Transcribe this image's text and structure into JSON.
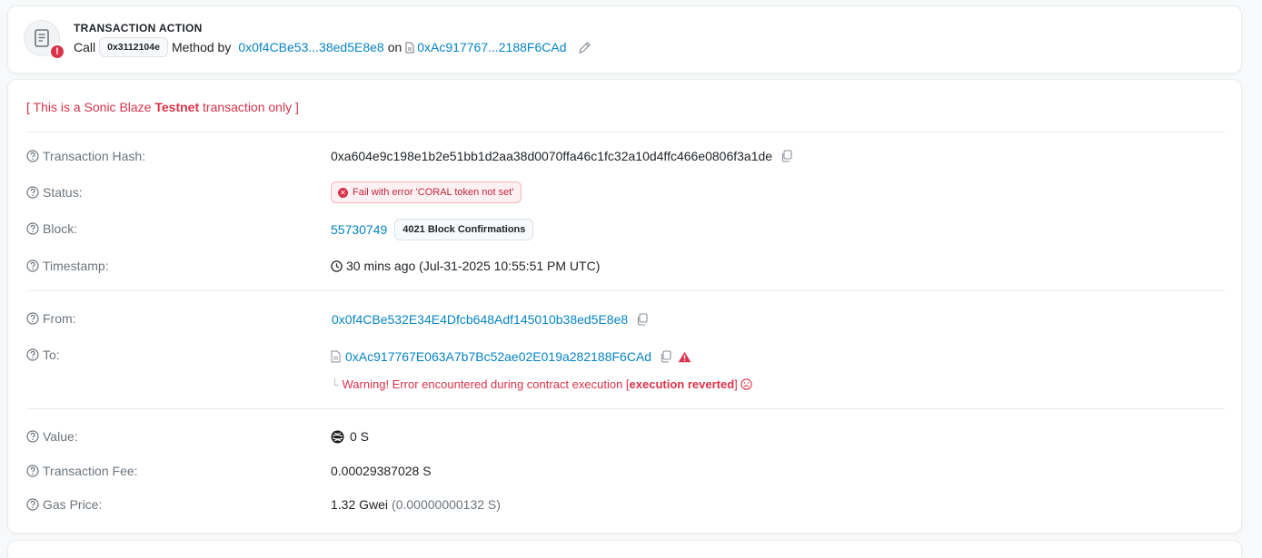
{
  "action": {
    "title": "TRANSACTION ACTION",
    "badge": "!",
    "call_label": "Call",
    "method_id": "0x3112104e",
    "method_by_label": "Method by",
    "from_short": "0x0f4CBe53...38ed5E8e8",
    "on_label": "on",
    "to_short": "0xAc917767...2188F6CAd"
  },
  "notice": {
    "prefix": "[ This is a Sonic Blaze ",
    "strong": "Testnet",
    "suffix": " transaction only ]"
  },
  "labels": {
    "hash": "Transaction Hash:",
    "status": "Status:",
    "block": "Block:",
    "timestamp": "Timestamp:",
    "from": "From:",
    "to": "To:",
    "value": "Value:",
    "fee": "Transaction Fee:",
    "gas_price": "Gas Price:"
  },
  "tx": {
    "hash": "0xa604e9c198e1b2e51bb1d2aa38d0070ffa46c1fc32a10d4ffc466e0806f3a1de",
    "status": "Fail with error 'CORAL token not set'",
    "block": "55730749",
    "confirmations": "4021 Block Confirmations",
    "timestamp": "30 mins ago (Jul-31-2025 10:55:51 PM UTC)",
    "from": "0x0f4CBe532E34E4Dfcb648Adf145010b38ed5E8e8",
    "to": "0xAc917767E063A7b7Bc52ae02E019a282188F6CAd",
    "warning_prefix": "Warning! Error encountered during contract execution [",
    "warning_strong": "execution reverted",
    "warning_suffix": "]",
    "value": "0 S",
    "fee": "0.00029387028 S",
    "gas_price": "1.32 Gwei",
    "gas_price_detail": "(0.00000000132 S)"
  },
  "colors": {
    "link": "#0784c3",
    "error": "#d9334a",
    "muted": "#6c757d"
  },
  "icons": [
    "document-icon",
    "alert-badge-icon",
    "contract-file-icon",
    "pencil-icon",
    "help-circle-icon",
    "copy-icon",
    "x-circle-icon",
    "clock-icon",
    "warning-triangle-icon",
    "sad-face-icon",
    "sonic-token-icon"
  ]
}
